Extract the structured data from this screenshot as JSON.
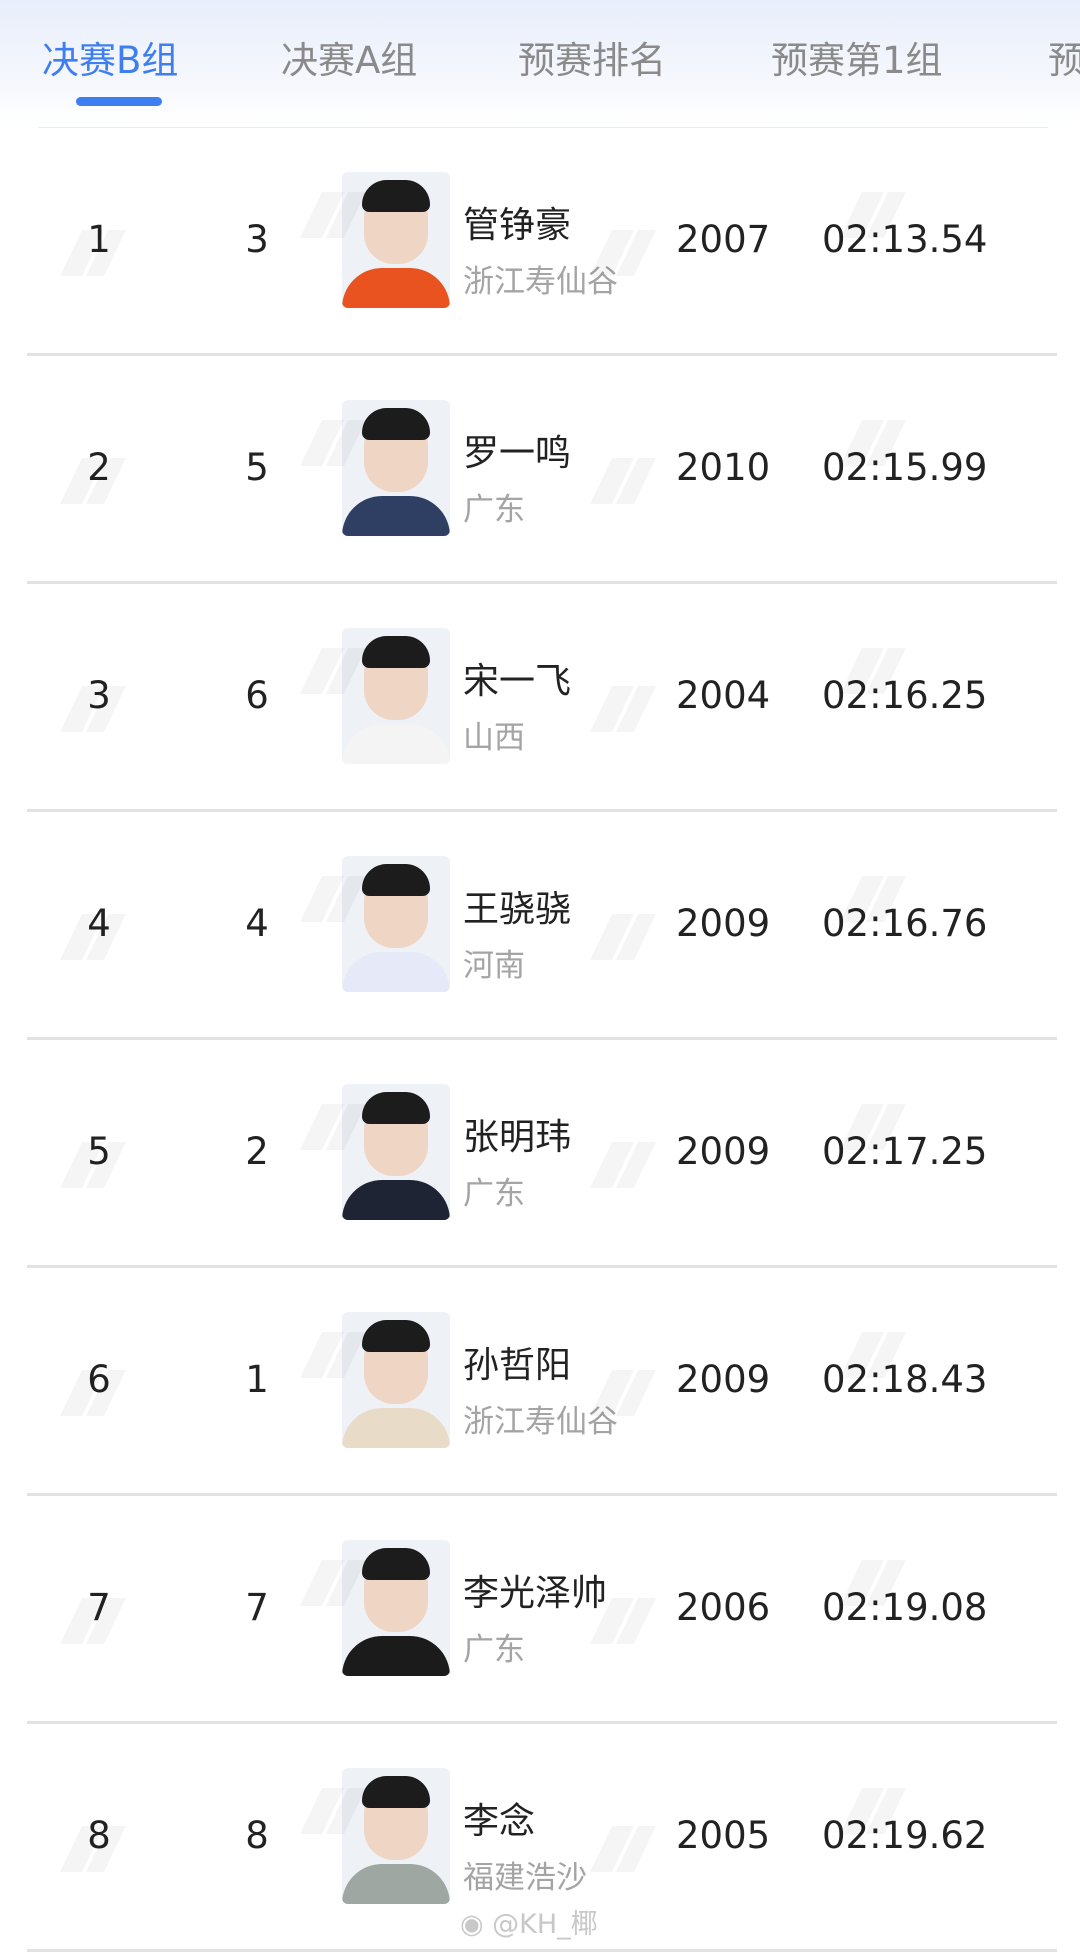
{
  "tabs": [
    {
      "label": "决赛B组",
      "active": true
    },
    {
      "label": "决赛A组",
      "active": false
    },
    {
      "label": "预赛排名",
      "active": false
    },
    {
      "label": "预赛第1组",
      "active": false
    },
    {
      "label": "预",
      "active": false
    }
  ],
  "rows": [
    {
      "rank": "1",
      "lane": "3",
      "name": "管铮豪",
      "team": "浙江寿仙谷",
      "year": "2007",
      "time": "02:13.54",
      "body_color": "#e8531f"
    },
    {
      "rank": "2",
      "lane": "5",
      "name": "罗一鸣",
      "team": "广东",
      "year": "2010",
      "time": "02:15.99",
      "body_color": "#2f3f63"
    },
    {
      "rank": "3",
      "lane": "6",
      "name": "宋一飞",
      "team": "山西",
      "year": "2004",
      "time": "02:16.25",
      "body_color": "#f4f4f4"
    },
    {
      "rank": "4",
      "lane": "4",
      "name": "王骁骁",
      "team": "河南",
      "year": "2009",
      "time": "02:16.76",
      "body_color": "#e6e9f7"
    },
    {
      "rank": "5",
      "lane": "2",
      "name": "张明玮",
      "team": "广东",
      "year": "2009",
      "time": "02:17.25",
      "body_color": "#1e2433"
    },
    {
      "rank": "6",
      "lane": "1",
      "name": "孙哲阳",
      "team": "浙江寿仙谷",
      "year": "2009",
      "time": "02:18.43",
      "body_color": "#e8dcc9"
    },
    {
      "rank": "7",
      "lane": "7",
      "name": "李光泽帅",
      "team": "广东",
      "year": "2006",
      "time": "02:19.08",
      "body_color": "#1b1b1b"
    },
    {
      "rank": "8",
      "lane": "8",
      "name": "李念",
      "team": "福建浩沙",
      "year": "2005",
      "time": "02:19.62",
      "body_color": "#9fa7a2"
    }
  ],
  "credit": "@KH_椰",
  "colors": {
    "accent": "#3f7ef0",
    "muted": "#a4a4a4",
    "divider": "#e2e2e2"
  }
}
